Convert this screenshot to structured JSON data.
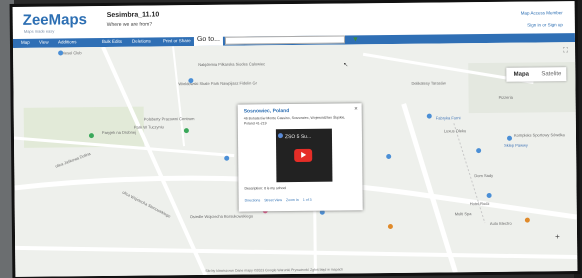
{
  "header": {
    "logo": "ZeeMaps",
    "tagline": "Maps made easy",
    "title": "Sesimbra_11.10",
    "subtitle": "Where we are from?",
    "right_top": "Map Access Member",
    "right_bottom": "Sign in  or  Sign up"
  },
  "menu": {
    "items": [
      "Map",
      "View",
      "Additions",
      "Bulk Edits",
      "Deletions",
      "Print or Share"
    ],
    "goto_label": "Go to..."
  },
  "map": {
    "type_map": "Mapa",
    "type_satellite": "Satelite",
    "labels": [
      "Diesel Club",
      "Nakjdemia Pilkarska Siodes Calowiec",
      "Wieldowski Skate Park Nawpijasz Fidelin Gr",
      "Polsberty Pracowni Centrum",
      "Park W Tuczyniu",
      "Paryjek na Drobnej",
      "Wojewódzki Szpital Dziecięcy",
      "Zespół Szkoł w Mosiczu",
      "Delikatesy Tarasów",
      "Pizzeria",
      "Fabryka Forni",
      "Luxus Oleku",
      "Kompleks Sportowy Sówdka",
      "Sklep Pawwy",
      "Dom Sady",
      "Hotel Rodz",
      "Multi Spa",
      "Auto Electro",
      "Osiedle Wojciecha Borsukowskiego",
      "ulica Jaśkowa Dolina",
      "ulica Wojciecha Stenowskiego"
    ]
  },
  "popup": {
    "title": "Sosnowiec, Poland",
    "address": "46 Bohaterów Monte Cassino, Sosnowiec, Województwo Śląskie, Poland 41-219",
    "video_title": "ZSO 5 Su...",
    "description": "Description: It is my school",
    "links": [
      "Directions",
      "Street View",
      "Zoom In",
      "1 of 3"
    ]
  },
  "footer": "Skróty klawiszowe  Dane mapy ©2023 Google  Warunki  Prywatność  Zgłoś błąd w mapach",
  "colors": {
    "brand": "#2d6fb3",
    "menubar": "#2f6fb5",
    "youtube_red": "#e52d27"
  }
}
